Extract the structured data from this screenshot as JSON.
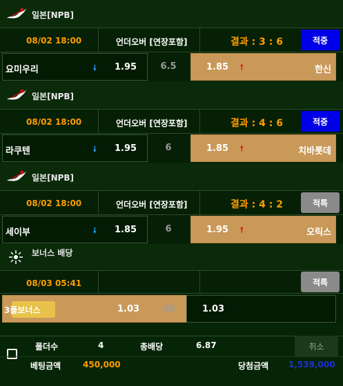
{
  "games": [
    {
      "league": "일본[NPB]",
      "time": "08/02 18:00",
      "market": "언더오버 [연장포함]",
      "result": "결과 : 3 : 6",
      "status": "적중",
      "home": "요미우리",
      "home_odds": "1.95",
      "line": "6.5",
      "away_odds": "1.85",
      "away": "한신"
    },
    {
      "league": "일본[NPB]",
      "time": "08/02 18:00",
      "market": "언더오버 [연장포함]",
      "result": "결과 : 4 : 6",
      "status": "적중",
      "home": "라쿠텐",
      "home_odds": "1.95",
      "line": "6",
      "away_odds": "1.85",
      "away": "치바롯데"
    },
    {
      "league": "일본[NPB]",
      "time": "08/02 18:00",
      "market": "언더오버 [연장포함]",
      "result": "결과 : 4 : 2",
      "status": "적특",
      "home": "세이부",
      "home_odds": "1.85",
      "line": "6",
      "away_odds": "1.95",
      "away": "오릭스"
    }
  ],
  "bonus": {
    "title": "보너스 배당",
    "time": "08/03 05:41",
    "status": "적특",
    "left_label": "3폴보너스",
    "left_odds": "1.03",
    "vs": "VS",
    "right_odds": "1.03"
  },
  "summary": {
    "folder_label": "폴더수",
    "folder_value": "4",
    "total_odds_label": "총배당",
    "total_odds_value": "6.87",
    "cancel_label": "취소",
    "bet_label": "베팅금액",
    "bet_value": "450,000",
    "win_label": "당첨금액",
    "win_value": "1,539,000"
  },
  "colors": {
    "win_blue": "#0000e8",
    "special_gray": "#8a8a8a",
    "orange": "#ff9c00",
    "selected": "#c9995a"
  }
}
